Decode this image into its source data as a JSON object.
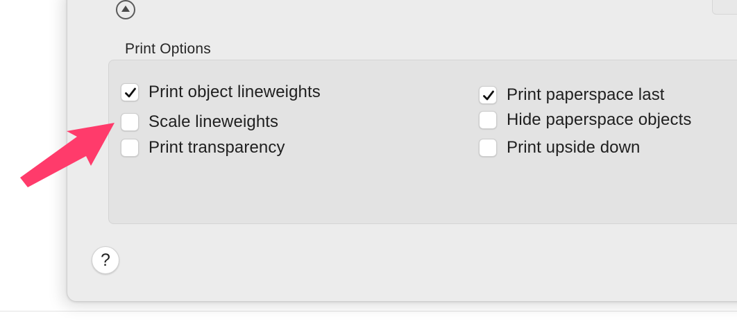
{
  "dialog": {
    "collapse_button_icon": "triangle-up-circle-icon",
    "section_title": "Print Options",
    "options": {
      "print_object_lineweights": {
        "label": "Print object lineweights",
        "checked": true
      },
      "scale_lineweights": {
        "label": "Scale lineweights",
        "checked": false
      },
      "print_transparency": {
        "label": "Print transparency",
        "checked": false
      },
      "print_paperspace_last": {
        "label": "Print paperspace last",
        "checked": true
      },
      "hide_paperspace_objects": {
        "label": "Hide paperspace objects",
        "checked": false
      },
      "print_upside_down": {
        "label": "Print upside down",
        "checked": false
      }
    },
    "help_button_label": "?"
  },
  "annotation": {
    "arrow_color": "#ff3b6b",
    "arrow_icon": "pointer-arrow-annotation"
  },
  "colors": {
    "dialog_background": "#ececec",
    "group_background": "#e3e3e3",
    "checkbox_background": "#ffffff"
  }
}
